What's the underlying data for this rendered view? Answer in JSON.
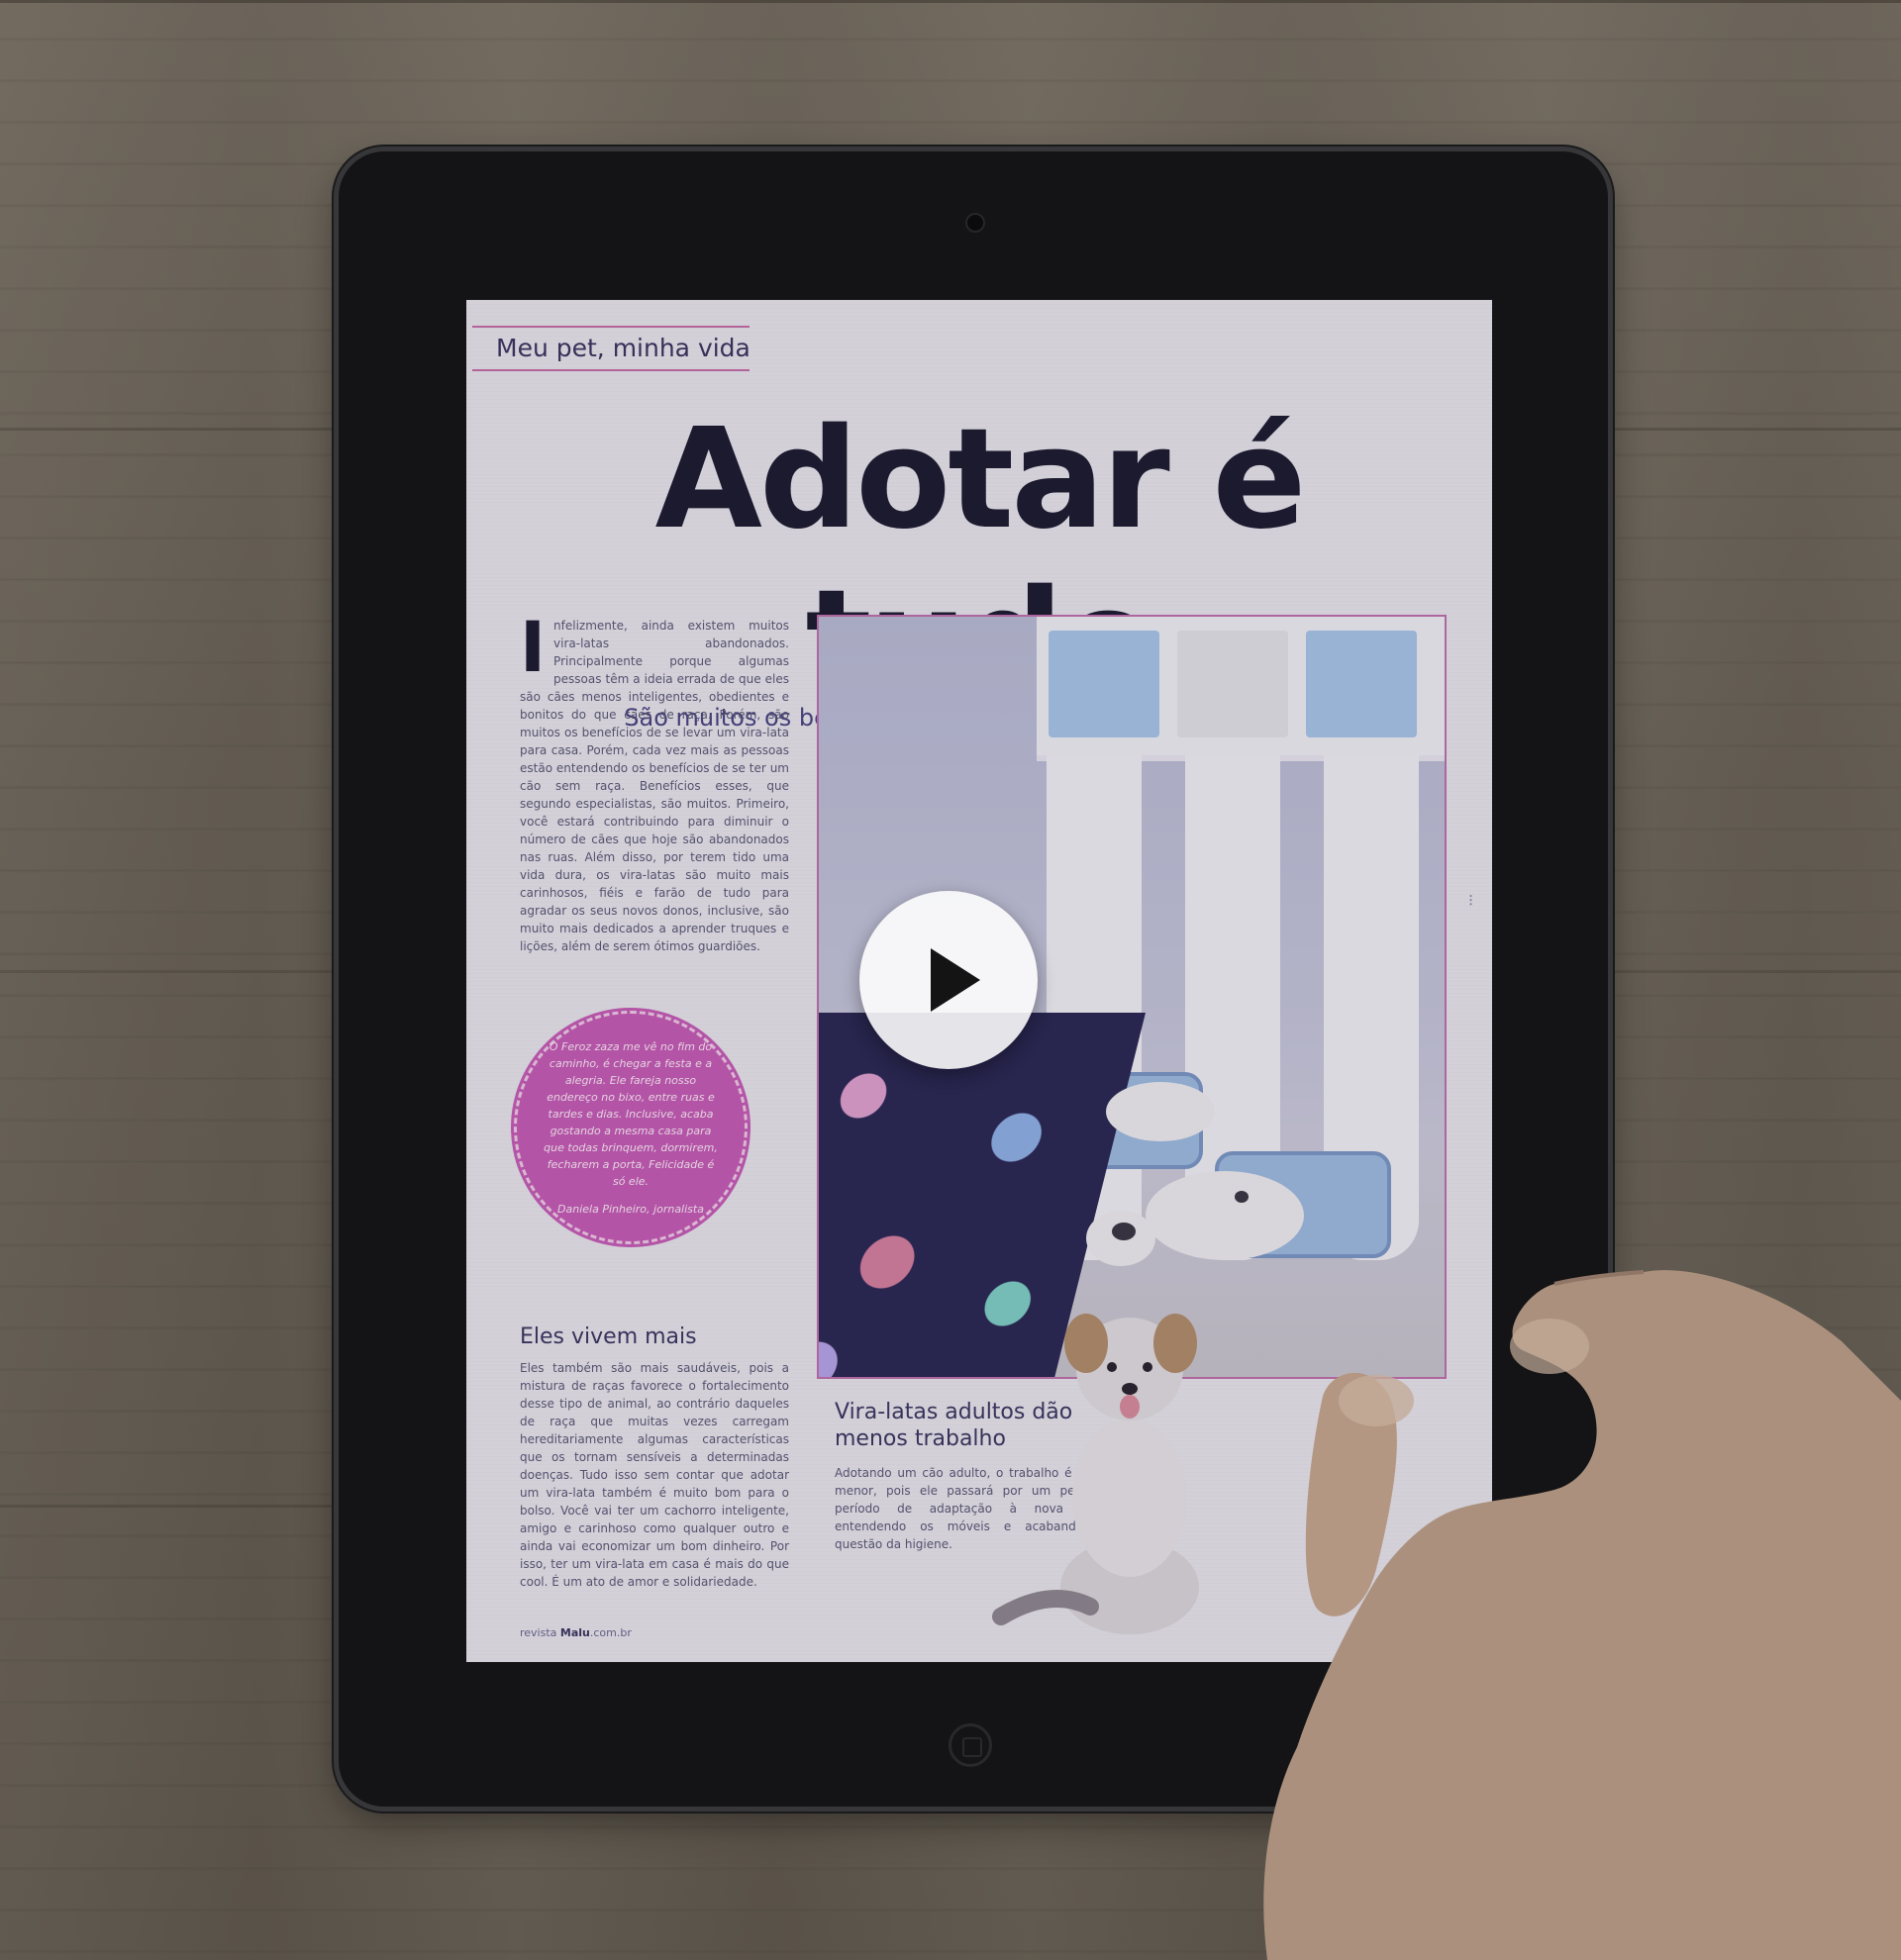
{
  "magazine": {
    "section": "Meu pet, minha vida",
    "headline": "Adotar é tudo",
    "subhead": "São muitos os benefícios de se levar um vira-lata para casa",
    "intro_drop_cap": "I",
    "intro_text": "nfelizmente, ainda existem muitos vira-latas abandonados. Principalmente porque algumas pessoas têm a ideia errada de que eles são cães menos inteligentes, obedientes e bonitos do que cães de raça. Porém, são muitos os benefícios de se levar um vira-lata para casa. Porém, cada vez mais as pessoas estão entendendo os benefícios de se ter um cão sem raça. Benefícios esses, que segundo especialistas, são muitos. Primeiro, você estará contribuindo para diminuir o número de cães que hoje são abandonados nas ruas. Além disso, por terem tido uma vida dura, os vira-latas são muito mais carinhosos, fiéis e farão de tudo para agradar os seus novos donos, inclusive, são muito mais dedicados a aprender truques e lições, além de serem ótimos guardiões.",
    "quote_text": "O Feroz zaza me vê no fim do caminho, é chegar a festa e a alegria. Ele fareja nosso endereço no bixo, entre ruas e tardes e dias. Inclusive, acaba gostando a mesma casa para que todas brinquem, dormirem, fecharem a porta, Felicidade é só ele.",
    "quote_author": "Daniela Pinheiro, jornalista",
    "section2_heading": "Eles vivem mais",
    "section2_text": "Eles também são mais saudáveis, pois a mistura de raças favorece o fortalecimento desse tipo de animal, ao contrário daqueles de raça que muitas vezes carregam hereditariamente algumas características que os tornam sensíveis a determinadas doenças. Tudo isso sem contar que adotar um vira-lata também é muito bom para o bolso. Você vai ter um cachorro inteligente, amigo e carinhoso como qualquer outro e ainda vai economizar um bom dinheiro. Por isso, ter um vira-lata em casa é mais do que cool. É um ato de amor e solidariedade.",
    "section3_heading": "Vira-latas adultos dão menos trabalho",
    "section3_text": "Adotando um cão adulto, o trabalho é muito menor, pois ele passará por um pequeno período de adaptação à nova casa, entendendo os móveis e acabando na questão da higiene.",
    "footer_prefix": "revista",
    "footer_brand": "Malu",
    "footer_suffix": ".com.br"
  },
  "video": {
    "play_icon": "play-icon"
  },
  "colors": {
    "accent_pink": "#c75cb8",
    "headline_navy": "#1c1b33",
    "subhead_violet": "#4a4484"
  }
}
